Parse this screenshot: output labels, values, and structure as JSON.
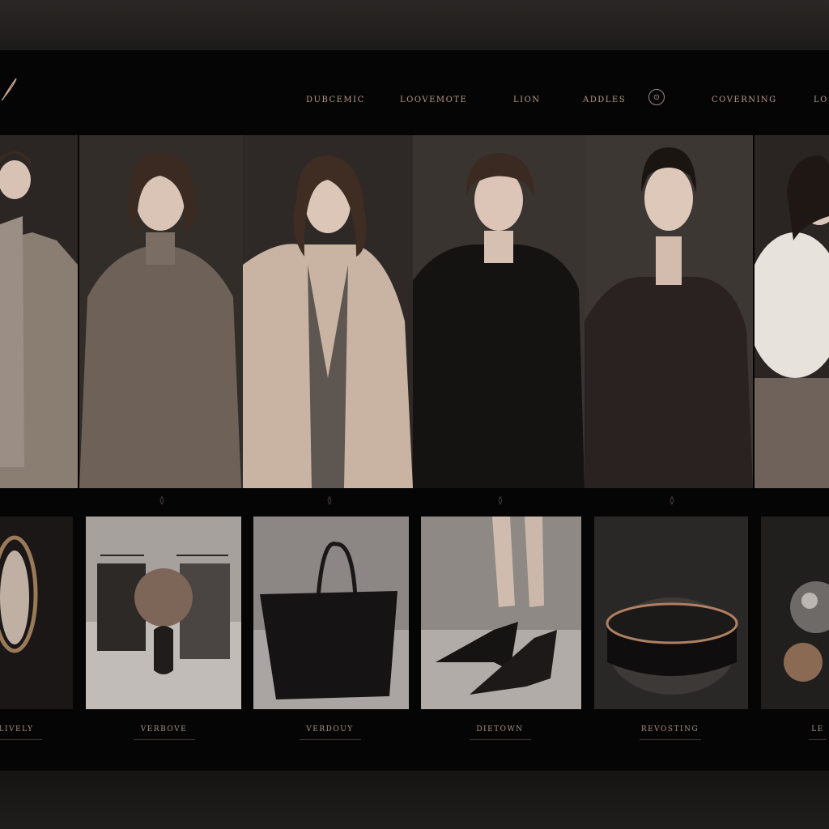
{
  "header": {
    "logo_icon": "script-monogram-icon",
    "nav": [
      "DUBCEMIC",
      "LOOVEMOTE",
      "LION",
      "ADDLES",
      "COVERNING",
      "LO"
    ],
    "circle_icon": "circle-monogram-icon"
  },
  "models": [
    {
      "name": "model-grey-knit-coat"
    },
    {
      "name": "model-taupe-knit-dress"
    },
    {
      "name": "model-beige-trench"
    },
    {
      "name": "model-black-tuxedo"
    },
    {
      "name": "model-black-lace-gown"
    },
    {
      "name": "model-white-fur-stole"
    }
  ],
  "products": [
    {
      "label": "LIVELY",
      "icon": "ornate-mirror-icon"
    },
    {
      "label": "VERBOVE",
      "icon": "clothing-rack-icon"
    },
    {
      "label": "VERDOUY",
      "icon": "tote-bag-icon"
    },
    {
      "label": "DIETOWN",
      "icon": "heel-shoe-icon"
    },
    {
      "label": "REVOSTING",
      "icon": "bangle-icon"
    },
    {
      "label": "LE",
      "icon": "glass-sphere-icon"
    }
  ],
  "colors": {
    "background": "#060505",
    "accent": "#b59a88"
  }
}
